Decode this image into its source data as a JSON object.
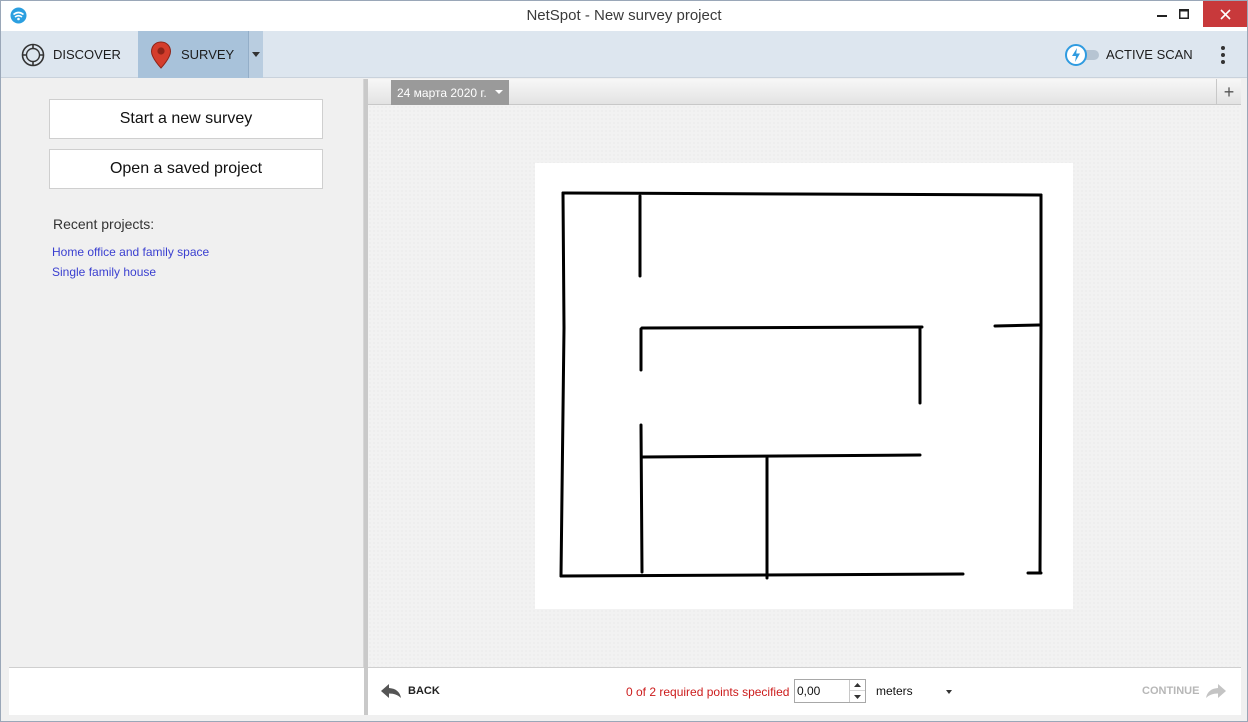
{
  "window": {
    "title": "NetSpot - New survey project"
  },
  "toolbar": {
    "discover_label": "DISCOVER",
    "survey_label": "SURVEY",
    "active_scan_label": "ACTIVE SCAN",
    "active_scan_enabled": false
  },
  "left_panel": {
    "start_button": "Start a new survey",
    "open_button": "Open a saved project",
    "recent_title": "Recent projects:",
    "recent_projects": [
      "Home office and family space",
      "Single family house"
    ]
  },
  "tabs": {
    "active_tab": "24 марта 2020 г.",
    "add_label": "+"
  },
  "footer": {
    "back_label": "BACK",
    "status_text": "0 of 2 required points specified",
    "distance_value": "0,00",
    "units_selected": "meters",
    "continue_label": "CONTINUE"
  },
  "colors": {
    "survey_active": "#a8c2da",
    "toolbar_bg": "#dde6ef",
    "status_red": "#cc1c1c",
    "link_blue": "#3a3fd0",
    "close_red": "#c8393b"
  }
}
